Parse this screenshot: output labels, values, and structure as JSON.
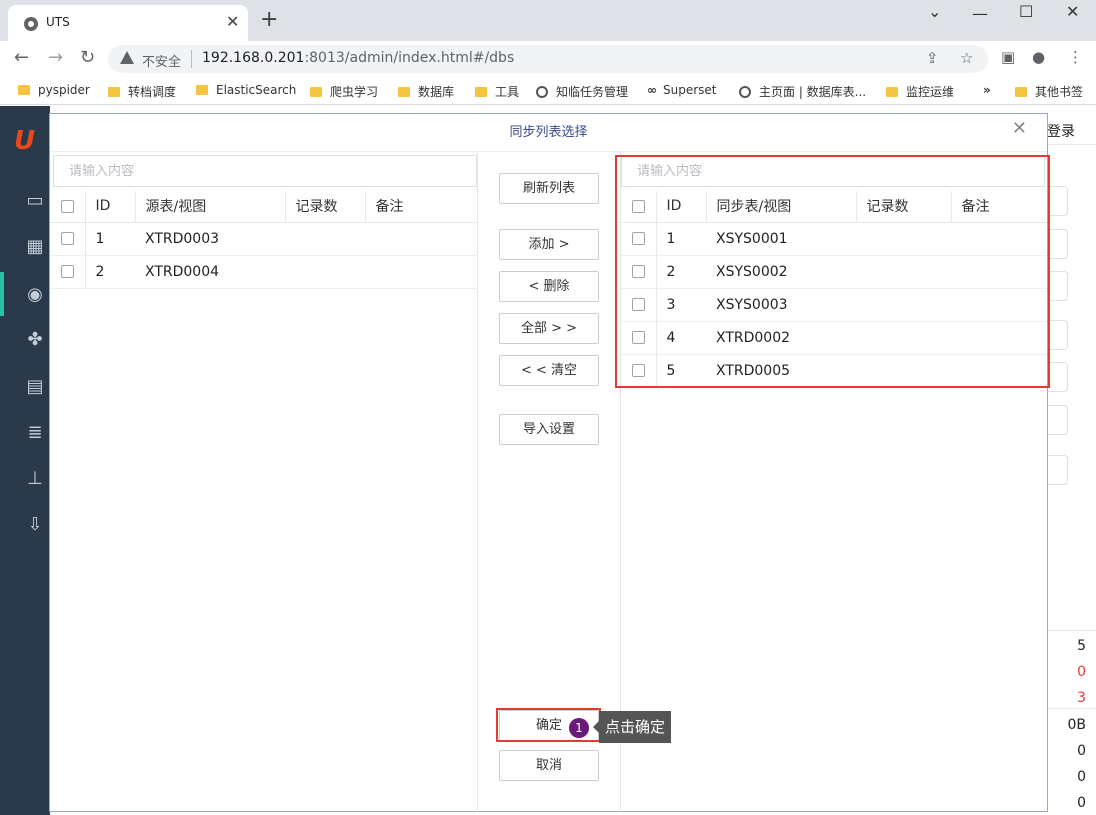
{
  "browser": {
    "tab_title": "UTS",
    "omnibox_label": "不安全",
    "url_host": "192.168.0.201",
    "url_rest": ":8013/admin/index.html#/dbs",
    "bookmarks": [
      {
        "label": "pyspider",
        "icon": "folder-icon"
      },
      {
        "label": "转档调度",
        "icon": "folder-icon"
      },
      {
        "label": "ElasticSearch",
        "icon": "folder-icon"
      },
      {
        "label": "爬虫学习",
        "icon": "folder-icon"
      },
      {
        "label": "数据库",
        "icon": "folder-icon"
      },
      {
        "label": "工具",
        "icon": "folder-icon"
      },
      {
        "label": "知临任务管理",
        "icon": "globe-icon"
      },
      {
        "label": "Superset",
        "icon": "link-icon"
      },
      {
        "label": "主页面 | 数据库表...",
        "icon": "globe-icon"
      },
      {
        "label": "监控运维",
        "icon": "folder-icon"
      },
      {
        "label": "其他书签",
        "icon": "folder-icon"
      }
    ]
  },
  "app": {
    "header_right": "登录",
    "bg_numbers": [
      "5",
      "0",
      "3",
      "0B",
      "0",
      "0",
      "0"
    ]
  },
  "dialog": {
    "title": "同步列表选择",
    "left": {
      "search_placeholder": "请输入内容",
      "columns": [
        "ID",
        "源表/视图",
        "记录数",
        "备注"
      ],
      "rows": [
        {
          "id": "1",
          "name": "XTRD0003",
          "count": "",
          "note": ""
        },
        {
          "id": "2",
          "name": "XTRD0004",
          "count": "",
          "note": ""
        }
      ]
    },
    "right": {
      "search_placeholder": "请输入内容",
      "columns": [
        "ID",
        "同步表/视图",
        "记录数",
        "备注"
      ],
      "rows": [
        {
          "id": "1",
          "name": "XSYS0001",
          "count": "",
          "note": ""
        },
        {
          "id": "2",
          "name": "XSYS0002",
          "count": "",
          "note": ""
        },
        {
          "id": "3",
          "name": "XSYS0003",
          "count": "",
          "note": ""
        },
        {
          "id": "4",
          "name": "XTRD0002",
          "count": "",
          "note": ""
        },
        {
          "id": "5",
          "name": "XTRD0005",
          "count": "",
          "note": ""
        }
      ]
    },
    "buttons": {
      "refresh": "刷新列表",
      "add": "添加 >",
      "remove": "< 删除",
      "add_all": "全部 > >",
      "clear": "< < 清空",
      "import_settings": "导入设置",
      "confirm": "确定",
      "cancel": "取消"
    }
  },
  "annotation": {
    "step_number": "1",
    "tooltip": "点击确定",
    "color": "#e53935"
  }
}
